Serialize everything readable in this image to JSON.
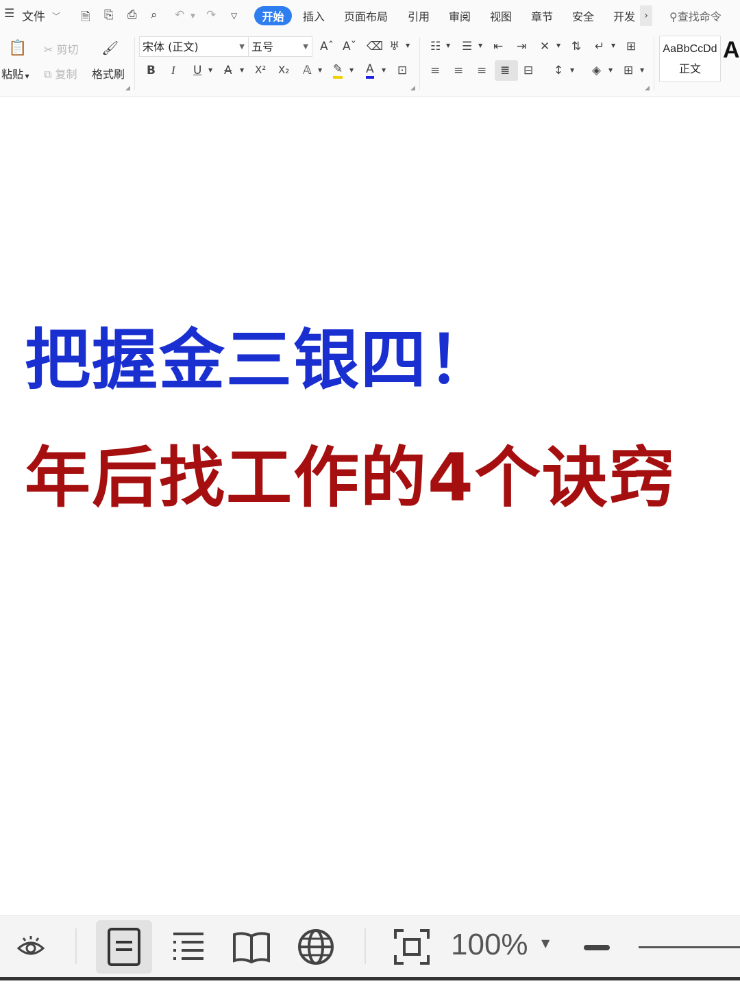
{
  "menubar": {
    "file_label": "文件",
    "tabs": [
      "开始",
      "插入",
      "页面布局",
      "引用",
      "审阅",
      "视图",
      "章节",
      "安全",
      "开发"
    ],
    "more_arrow": "›",
    "search_label": "查找命令"
  },
  "ribbon": {
    "paste_label": "粘贴",
    "cut_label": "剪切",
    "copy_label": "复制",
    "format_painter_label": "格式刷",
    "font_name": "宋体 (正文)",
    "font_size": "五号",
    "bold_label": "B",
    "italic_label": "I",
    "underline_label": "U",
    "strike_label": "A",
    "superscript_label": "X²",
    "subscript_label": "X₂",
    "style_sample": "AaBbCcDd",
    "style_name": "正文",
    "style_next": "A"
  },
  "document": {
    "title_line1": "把握金三银四！",
    "title_line2": "年后找工作的4个诀窍"
  },
  "statusbar": {
    "zoom_value": "100%"
  },
  "colors": {
    "accent": "#2f7ef0",
    "title1": "#1a2fd0",
    "title2": "#a50f0f"
  }
}
